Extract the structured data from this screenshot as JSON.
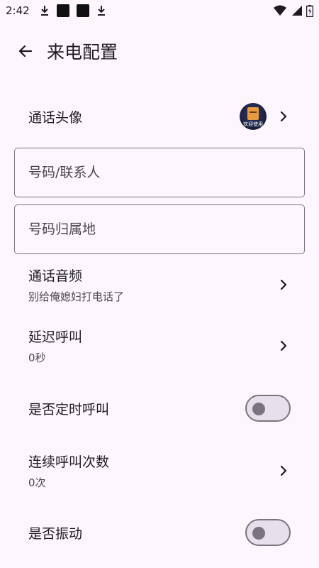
{
  "status_bar": {
    "time": "2:42"
  },
  "header": {
    "title": "来电配置"
  },
  "settings": {
    "avatar": {
      "label": "通话头像",
      "avatar_caption": "欢迎使用"
    },
    "number_field": {
      "placeholder": "号码/联系人",
      "value": ""
    },
    "location_field": {
      "placeholder": "号码归属地",
      "value": ""
    },
    "audio": {
      "label": "通话音频",
      "value": "别给俺媳妇打电话了"
    },
    "delay": {
      "label": "延迟呼叫",
      "value": "0秒"
    },
    "scheduled": {
      "label": "是否定时呼叫",
      "enabled": false
    },
    "repeat": {
      "label": "连续呼叫次数",
      "value": "0次"
    },
    "vibrate": {
      "label": "是否振动",
      "enabled": false
    }
  }
}
